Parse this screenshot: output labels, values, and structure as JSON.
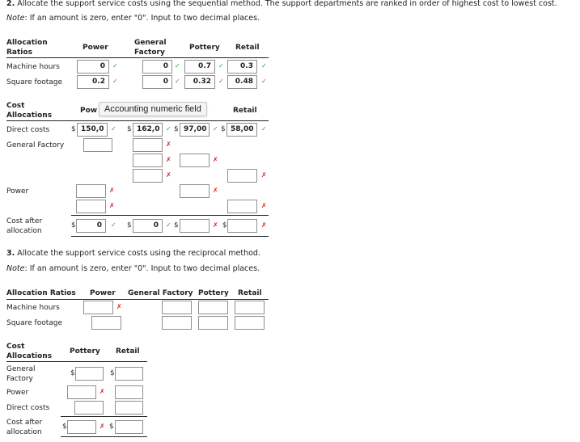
{
  "q2": {
    "number": "2.",
    "text": " Allocate the support service costs using the sequential method. The support departments are ranked in order of highest cost to lowest cost.",
    "note_label": "Note",
    "note_text": ": If an amount is zero, enter \"0\". Input to two decimal places.",
    "ratios": {
      "header": "Allocation Ratios",
      "header_l1": "Allocation",
      "header_l2": "Ratios",
      "columns": [
        "Power",
        "General",
        "Pottery",
        "Retail"
      ],
      "col_gf_l1": "General",
      "col_gf_l2": "Factory",
      "rows": [
        {
          "label": "Machine hours",
          "values": [
            "0",
            "0",
            "0.7",
            "0.3"
          ],
          "status": [
            "ok",
            "ok",
            "ok",
            "ok"
          ]
        },
        {
          "label": "Square footage",
          "values": [
            "0.2",
            "0",
            "0.32",
            "0.48"
          ],
          "status": [
            "ok",
            "ok",
            "ok",
            "ok"
          ]
        }
      ]
    },
    "costs": {
      "header_l1": "Cost",
      "header_l2": "Allocations",
      "col_power": "Pow",
      "col_retail": "Retail",
      "tooltip": "Accounting numeric field",
      "direct_label": "Direct costs",
      "direct_values": [
        "150,0",
        "162,0",
        "97,00",
        "58,00"
      ],
      "gf_label": "General Factory",
      "power_label": "Power",
      "after_l1": "Cost after",
      "after_l2": "allocation",
      "after_values": [
        "0",
        "0",
        "",
        ""
      ],
      "currency": "$"
    }
  },
  "q3": {
    "number": "3.",
    "text": " Allocate the support service costs using the reciprocal method.",
    "note_label": "Note",
    "note_text": ": If an amount is zero, enter \"0\". Input to two decimal places.",
    "ratios": {
      "header": "Allocation Ratios",
      "columns": [
        "Power",
        "General Factory",
        "Pottery",
        "Retail"
      ],
      "rows": [
        {
          "label": "Machine hours"
        },
        {
          "label": "Square footage"
        }
      ]
    },
    "costs": {
      "header_l1": "Cost",
      "header_l2": "Allocations",
      "columns": [
        "Pottery",
        "Retail"
      ],
      "gf_l1": "General",
      "gf_l2": "Factory",
      "power_label": "Power",
      "direct_label": "Direct costs",
      "after_l1": "Cost after",
      "after_l2": "allocation",
      "currency": "$"
    }
  },
  "marks": {
    "ok": "✓",
    "bad": "✗"
  },
  "colors": {
    "ok": "#2e9e2e",
    "bad": "#d81c1c"
  }
}
